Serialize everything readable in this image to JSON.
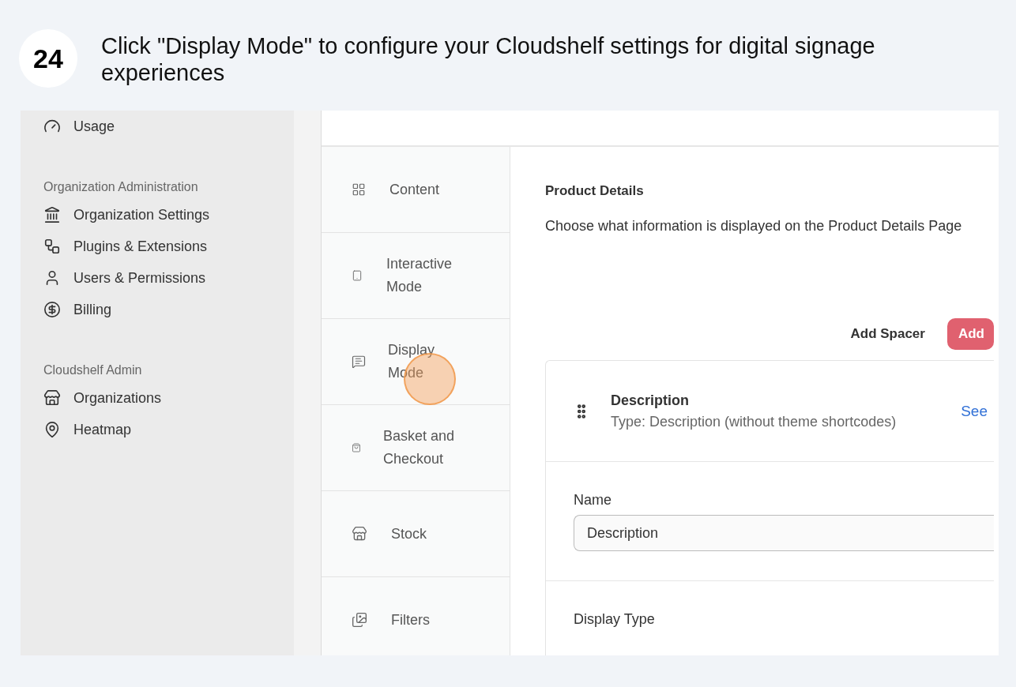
{
  "step": {
    "number": "24",
    "instruction": "Click \"Display Mode\" to configure your Cloudshelf settings for digital signage experiences"
  },
  "sidebar": {
    "top_items": [
      {
        "label": "Usage"
      }
    ],
    "sections": [
      {
        "title": "Organization Administration",
        "items": [
          {
            "label": "Organization Settings"
          },
          {
            "label": "Plugins & Extensions"
          },
          {
            "label": "Users & Permissions"
          },
          {
            "label": "Billing"
          }
        ]
      },
      {
        "title": "Cloudshelf Admin",
        "items": [
          {
            "label": "Organizations"
          },
          {
            "label": "Heatmap"
          }
        ]
      }
    ]
  },
  "tabs": [
    {
      "label": "Content",
      "selected": false
    },
    {
      "label": "Interactive Mode",
      "selected": false
    },
    {
      "label": "Display Mode",
      "selected": false
    },
    {
      "label": "Basket and Checkout",
      "selected": false
    },
    {
      "label": "Stock",
      "selected": false
    },
    {
      "label": "Filters",
      "selected": false
    }
  ],
  "panel": {
    "title": "Product Details",
    "description": "Choose what information is displayed on the Product Details Page",
    "buttons": [
      {
        "label": "Add Spacer",
        "kind": "plain"
      },
      {
        "label": "Add",
        "kind": "primary"
      }
    ],
    "block": {
      "title": "Description",
      "subtitle": "Type: Description (without theme shortcodes)",
      "link": "See",
      "name_label": "Name",
      "name_value": "Description",
      "display_type_label": "Display Type"
    }
  }
}
